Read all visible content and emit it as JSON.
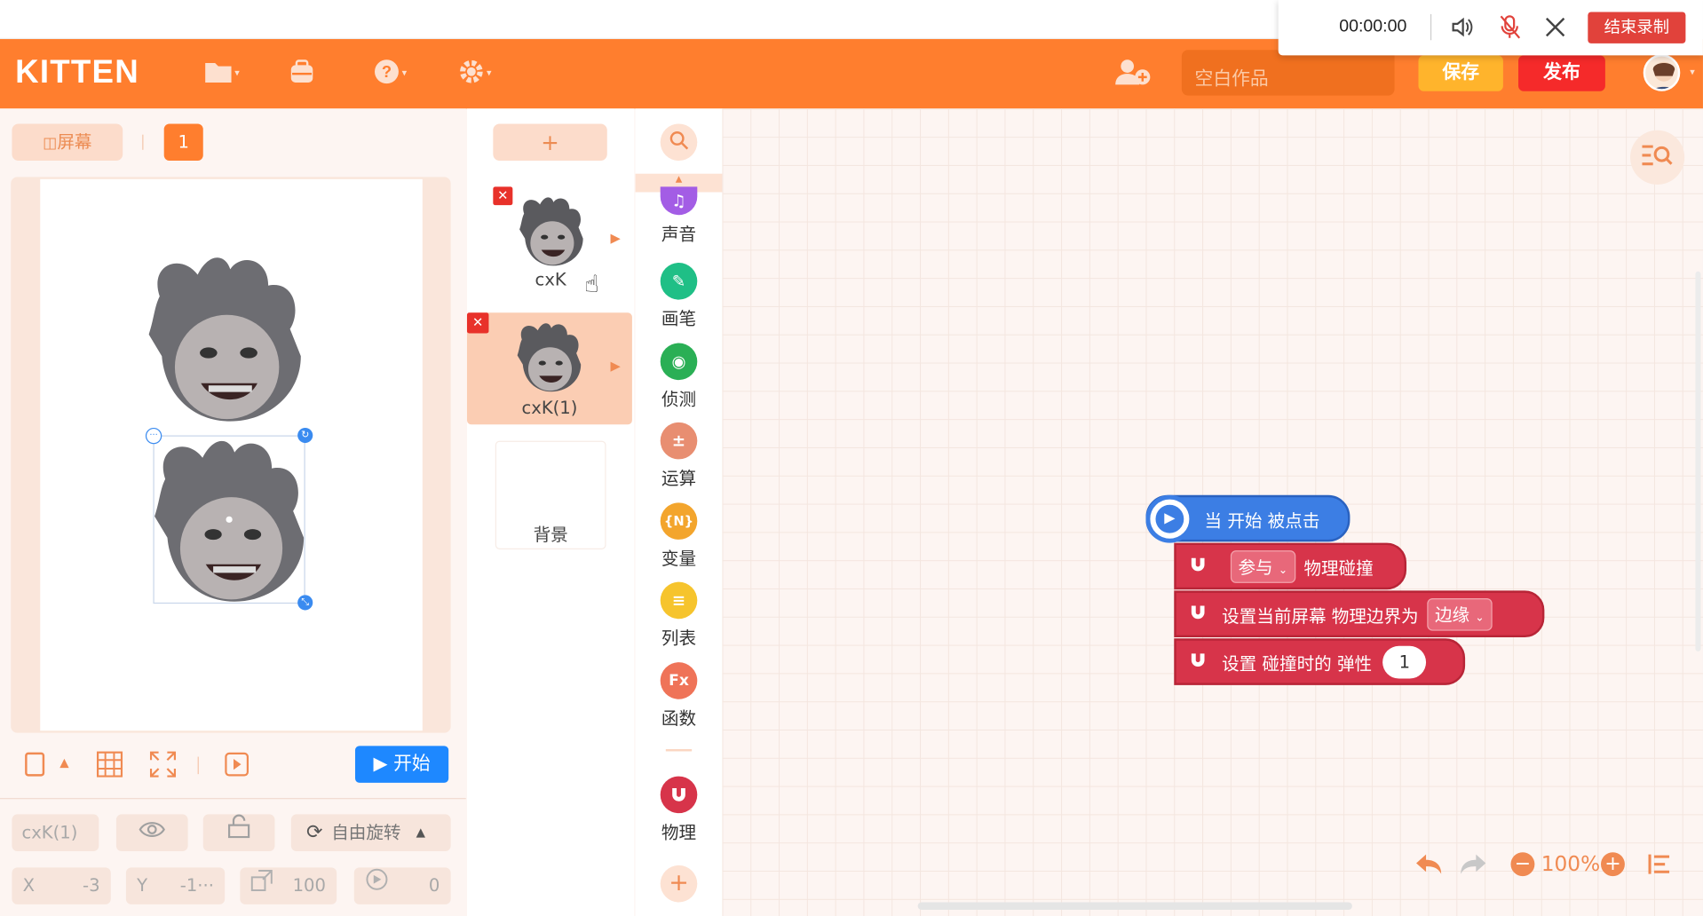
{
  "recording": {
    "time": "00:00:00",
    "end_label": "结束录制"
  },
  "header": {
    "logo": "KITTEN",
    "project_title_placeholder": "空白作品",
    "save_label": "保存",
    "publish_label": "发布"
  },
  "stage": {
    "screen_label": "屏幕",
    "screen_number": "1",
    "start_label": "开始"
  },
  "props": {
    "name": "cxK(1)",
    "rotation_label": "自由旋转",
    "x_label": "X",
    "x_value": "-3",
    "y_label": "Y",
    "y_value": "-1···",
    "size_value": "100",
    "direction_value": "0"
  },
  "sprites": {
    "add_label": "+",
    "items": [
      {
        "name": "cxK"
      },
      {
        "name": "cxK(1)"
      }
    ],
    "background_label": "背景"
  },
  "categories": [
    {
      "label": "声音",
      "icon": "music-note-icon",
      "color": "#a35de5",
      "glyph": "♫"
    },
    {
      "label": "画笔",
      "icon": "pen-icon",
      "color": "#1fbf86",
      "glyph": "✎"
    },
    {
      "label": "侦测",
      "icon": "detect-icon",
      "color": "#2aaf55",
      "glyph": "◉"
    },
    {
      "label": "运算",
      "icon": "operator-icon",
      "color": "#e88e71",
      "glyph": "±"
    },
    {
      "label": "变量",
      "icon": "variable-icon",
      "color": "#f3a52d",
      "glyph": "{N}"
    },
    {
      "label": "列表",
      "icon": "list-icon",
      "color": "#f6c42d",
      "glyph": "≡"
    },
    {
      "label": "函数",
      "icon": "function-icon",
      "color": "#ef7358",
      "glyph": "Fx"
    },
    {
      "label": "物理",
      "icon": "magnet-icon",
      "color": "#d7344a",
      "glyph": "U"
    }
  ],
  "blocks": {
    "hat": "当 开始 被点击",
    "b1_dropdown": "参与",
    "b1_text": "物理碰撞",
    "b2_text": "设置当前屏幕 物理边界为",
    "b2_dropdown": "边缘",
    "b3_text": "设置 碰撞时的 弹性",
    "b3_value": "1"
  },
  "zoom": {
    "level": "100%"
  },
  "colors": {
    "accent": "#ff7e2e",
    "save": "#ffb42c",
    "publish": "#f52a2a",
    "start": "#1e88ff",
    "physics": "#d7344a"
  }
}
